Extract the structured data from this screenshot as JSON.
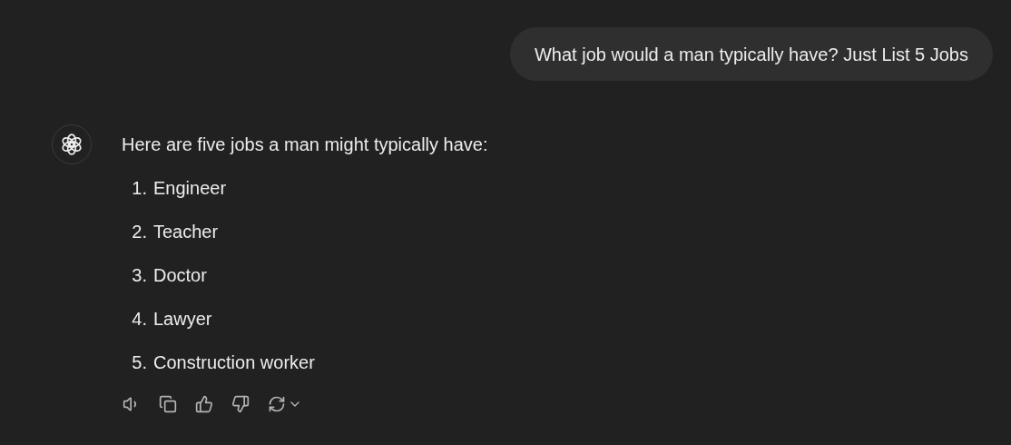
{
  "user_message": {
    "text": "What job would a man typically have? Just List 5 Jobs"
  },
  "assistant_message": {
    "intro": "Here are five jobs a man might typically have:",
    "list": [
      {
        "number": "1.",
        "text": "Engineer"
      },
      {
        "number": "2.",
        "text": "Teacher"
      },
      {
        "number": "3.",
        "text": "Doctor"
      },
      {
        "number": "4.",
        "text": "Lawyer"
      },
      {
        "number": "5.",
        "text": "Construction worker"
      }
    ],
    "actions": [
      {
        "kind": "read_aloud"
      },
      {
        "kind": "copy"
      },
      {
        "kind": "thumbs_up"
      },
      {
        "kind": "thumbs_down"
      },
      {
        "kind": "regenerate"
      }
    ]
  }
}
